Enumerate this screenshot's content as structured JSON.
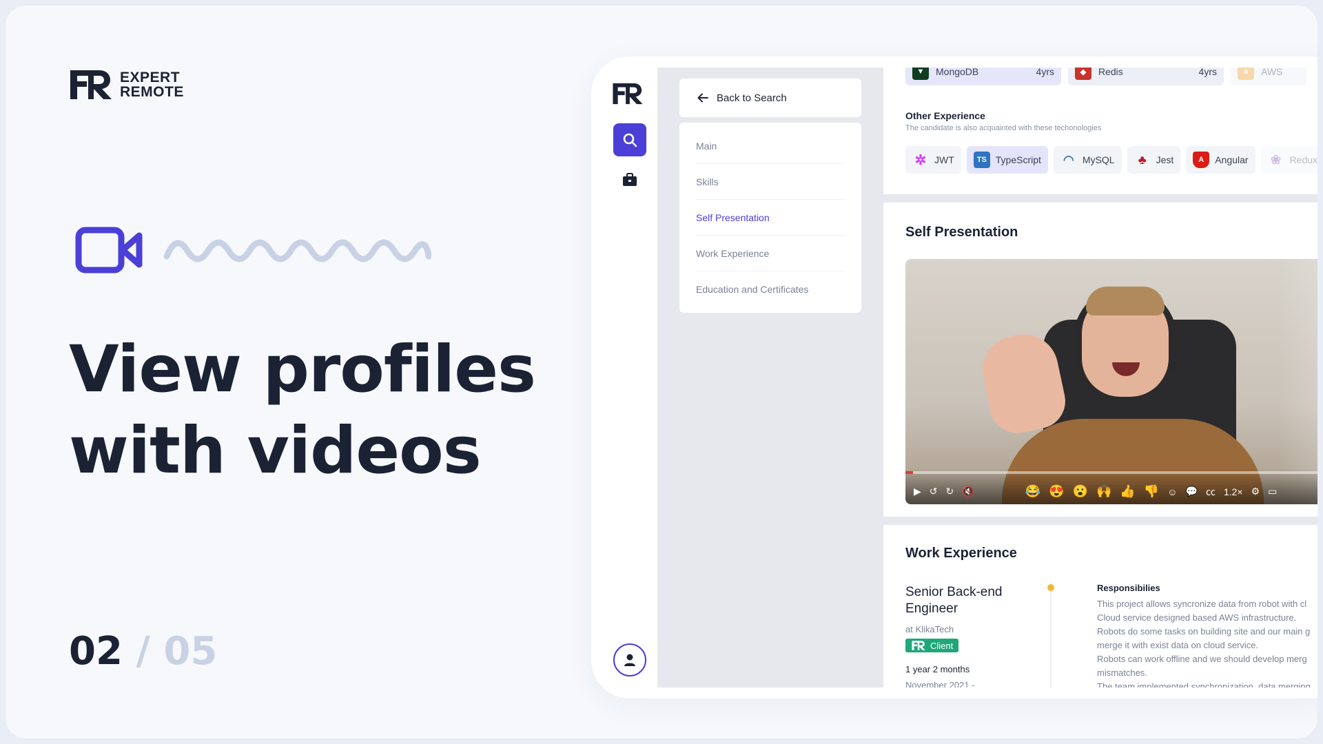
{
  "brand": {
    "line1": "EXPERT",
    "line2": "REMOTE"
  },
  "hero": {
    "line1": "View profiles",
    "line2": "with videos"
  },
  "pager": {
    "current": "02",
    "separator": "/",
    "total": "05"
  },
  "colors": {
    "accent": "#4b3fd8",
    "ink": "#1b2233",
    "muted": "#7a8296",
    "client": "#1fa77a",
    "timeline_dot": "#f5b731"
  },
  "app": {
    "back_label": "Back to Search",
    "nav": [
      {
        "label": "Main",
        "active": false
      },
      {
        "label": "Skills",
        "active": false
      },
      {
        "label": "Self Presentation",
        "active": true
      },
      {
        "label": "Work Experience",
        "active": false
      },
      {
        "label": "Education and Certificates",
        "active": false
      }
    ],
    "main_stack": [
      {
        "name": "MongoDB",
        "years": "4yrs",
        "icon": "mongodb-icon"
      },
      {
        "name": "Redis",
        "years": "4yrs",
        "icon": "redis-icon"
      },
      {
        "name": "AWS",
        "years": "",
        "icon": "aws-icon"
      }
    ],
    "other_experience": {
      "title": "Other Experience",
      "subtitle": "The candidate is also acquainted with these techonologies",
      "items": [
        {
          "name": "JWT",
          "icon": "jwt-icon",
          "selected": false
        },
        {
          "name": "TypeScript",
          "icon": "typescript-icon",
          "selected": true
        },
        {
          "name": "MySQL",
          "icon": "mysql-icon",
          "selected": false
        },
        {
          "name": "Jest",
          "icon": "jest-icon",
          "selected": false
        },
        {
          "name": "Angular",
          "icon": "angular-icon",
          "selected": false
        },
        {
          "name": "Redux",
          "icon": "redux-icon",
          "selected": false
        }
      ]
    },
    "self_presentation": {
      "title": "Self Presentation",
      "comments_count": "0",
      "speed": "1.2×",
      "progress": 0.004
    },
    "work_experience": {
      "title": "Work Experience",
      "job_title": "Senior Back-end Engineer",
      "company": "at KlikaTech",
      "badge": "Client",
      "duration": "1 year 2 months",
      "start": "November 2021 -",
      "responsibilities_title": "Responsibilies",
      "responsibilities": [
        "This project allows syncronize data from robot with cl",
        "Cloud service designed based AWS infrastructure.",
        "Robots do some tasks on building site and our main g",
        "merge it with exist data on cloud service.",
        "Robots can work offline and we should develop merg",
        "mismatches.",
        "The team implemented synchronization, data merging"
      ]
    }
  }
}
